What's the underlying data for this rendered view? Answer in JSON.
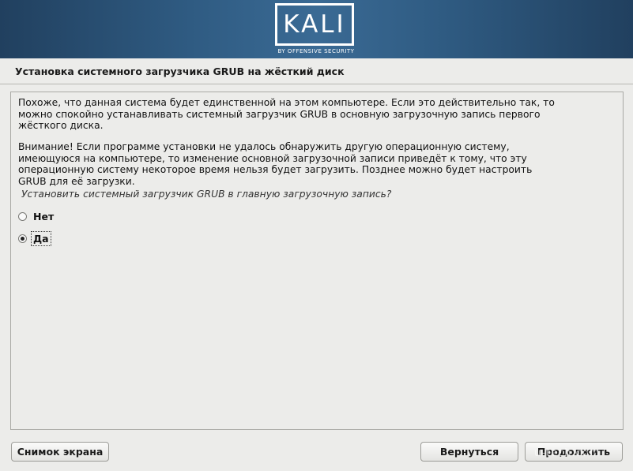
{
  "banner": {
    "logo_text": "KALI",
    "logo_subtitle": "BY OFFENSIVE SECURITY"
  },
  "header": {
    "title": "Установка системного загрузчика GRUB на жёсткий диск"
  },
  "main": {
    "paragraph1": "Похоже, что данная система будет единственной на этом компьютере. Если это действительно так, то\nможно спокойно устанавливать системный загрузчик GRUB в основную загрузочную запись первого\nжёсткого диска.",
    "paragraph2": "Внимание! Если программе установки не удалось обнаружить другую операционную систему,\nимеющуюся на компьютере, то изменение основной загрузочной записи приведёт к тому, что эту\nоперационную систему некоторое время нельзя будет загрузить. Позднее можно будет настроить\nGRUB для её загрузки.",
    "question": "Установить системный загрузчик GRUB в главную загрузочную запись?",
    "options": [
      {
        "label": "Нет",
        "checked": false
      },
      {
        "label": "Да",
        "checked": true
      }
    ]
  },
  "footer": {
    "screenshot_label": "Снимок экрана",
    "back_label": "Вернуться",
    "continue_label": "Продолжить"
  },
  "watermark": "u-tech.com"
}
